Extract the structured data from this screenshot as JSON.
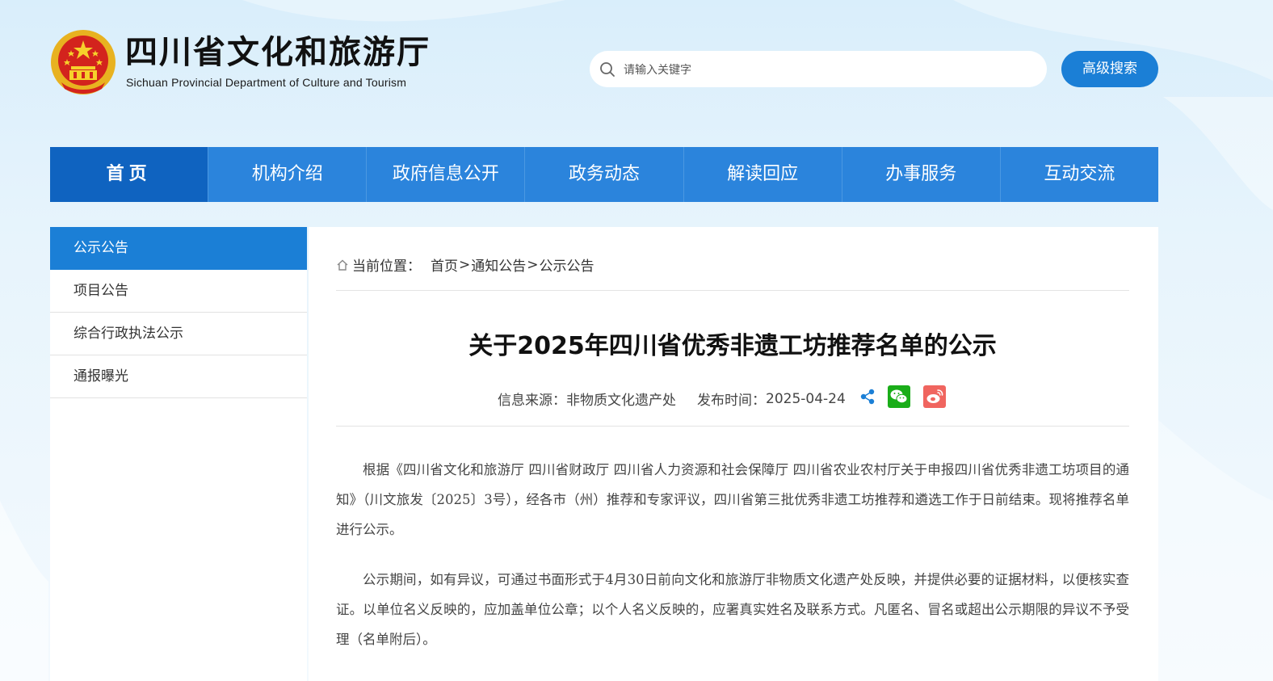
{
  "header": {
    "emblem_icon": "national-emblem",
    "title_cn": "四川省文化和旅游厅",
    "title_en": "Sichuan Provincial Department of Culture and Tourism",
    "search": {
      "placeholder": "请输入关键字",
      "value": "",
      "icon": "search-icon"
    },
    "advanced_search_label": "高级搜索"
  },
  "nav": {
    "items": [
      {
        "label": "首页",
        "active": true
      },
      {
        "label": "机构介绍"
      },
      {
        "label": "政府信息公开"
      },
      {
        "label": "政务动态"
      },
      {
        "label": "解读回应"
      },
      {
        "label": "办事服务"
      },
      {
        "label": "互动交流"
      }
    ]
  },
  "sidebar": {
    "items": [
      {
        "label": "公示公告",
        "active": true
      },
      {
        "label": "项目公告"
      },
      {
        "label": "综合行政执法公示"
      },
      {
        "label": "通报曝光"
      }
    ]
  },
  "breadcrumb": {
    "prefix": "当前位置：",
    "links": [
      "首页",
      "通知公告",
      "公示公告"
    ],
    "separator": ">"
  },
  "article": {
    "title": "关于2025年四川省优秀非遗工坊推荐名单的公示",
    "source_label": "信息来源：",
    "source": "非物质文化遗产处",
    "date_label": "发布时间：",
    "date": "2025-04-24",
    "share_icons": [
      "share-icon",
      "wechat-icon",
      "weibo-icon"
    ],
    "paragraphs": [
      "根据《四川省文化和旅游厅 四川省财政厅 四川省人力资源和社会保障厅 四川省农业农村厅关于申报四川省优秀非遗工坊项目的通知》（川文旅发〔2025〕3号），经各市（州）推荐和专家评议，四川省第三批优秀非遗工坊推荐和遴选工作于日前结束。现将推荐名单进行公示。",
      "公示期间，如有异议，可通过书面形式于4月30日前向文化和旅游厅非物质文化遗产处反映，并提供必要的证据材料，以便核实查证。以单位名义反映的，应加盖单位公章；以个人名义反映的，应署真实姓名及联系方式。凡匿名、冒名或超出公示期限的异议不予受理（名单附后）。"
    ]
  },
  "colors": {
    "nav_bg": "#2b84dc",
    "nav_active": "#0f63c0",
    "accent": "#1b7fd6",
    "wechat": "#1aad19",
    "weibo": "#f0655f"
  }
}
